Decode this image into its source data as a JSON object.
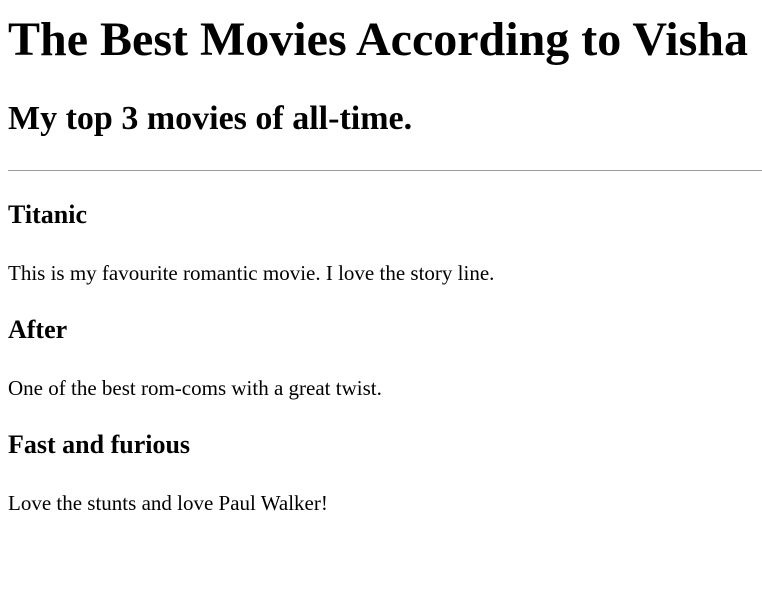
{
  "page": {
    "title": "The Best Movies According to Visha",
    "subtitle": "My top 3 movies of all-time."
  },
  "movies": [
    {
      "title": "Titanic",
      "description": "This is my favourite romantic movie. I love the story line."
    },
    {
      "title": "After",
      "description": "One of the best rom-coms with a great twist."
    },
    {
      "title": "Fast and furious",
      "description": "Love the stunts and love Paul Walker!"
    }
  ]
}
